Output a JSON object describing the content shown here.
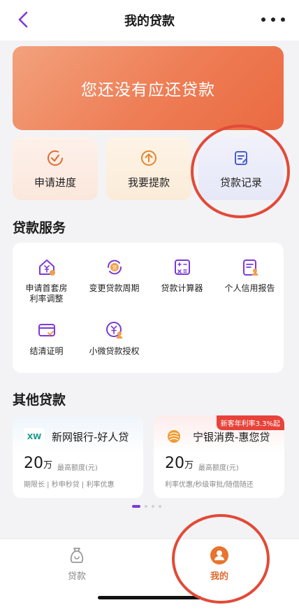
{
  "header": {
    "title": "我的贷款",
    "back_icon": "chevron-left-icon",
    "more_icon": "more-dots-icon"
  },
  "banner": {
    "text": "您还没有应还贷款"
  },
  "quick_actions": [
    {
      "label": "申请进度",
      "icon": "progress-check-icon"
    },
    {
      "label": "我要提款",
      "icon": "withdraw-arrow-up-icon"
    },
    {
      "label": "贷款记录",
      "icon": "record-list-icon"
    }
  ],
  "services": {
    "title": "贷款服务",
    "items": [
      {
        "label_line1": "申请首套房",
        "label_line2": "利率调整",
        "icon": "house-yen-icon"
      },
      {
        "label_line1": "变更贷款周期",
        "label_line2": "",
        "icon": "loan-cycle-icon"
      },
      {
        "label_line1": "贷款计算器",
        "label_line2": "",
        "icon": "calculator-icon"
      },
      {
        "label_line1": "个人信用报告",
        "label_line2": "",
        "icon": "credit-report-icon"
      },
      {
        "label_line1": "结清证明",
        "label_line2": "",
        "icon": "settlement-card-icon"
      },
      {
        "label_line1": "小微贷款授权",
        "label_line2": "",
        "icon": "yen-person-icon"
      }
    ]
  },
  "other_loans": {
    "title": "其他贷款",
    "items": [
      {
        "name": "新网银行-好人贷",
        "logo_text": "XW",
        "amount": "20",
        "unit": "万",
        "hint": "最高额度(元)",
        "tags": "期限长 | 秒申秒贷 | 利率优惠",
        "badge": ""
      },
      {
        "name": "宁银消费-惠您贷",
        "logo_text": "",
        "amount": "20",
        "unit": "万",
        "hint": "最高额度(元)",
        "tags": "利率优惠/秒级审批/随借随还",
        "badge": "新客年利率3.3%起"
      }
    ]
  },
  "tabs": [
    {
      "label": "贷款",
      "icon": "money-bag-icon",
      "active": false
    },
    {
      "label": "我的",
      "icon": "user-profile-icon",
      "active": true
    }
  ],
  "colors": {
    "accent": "#7b3ad6",
    "banner": "#ee7d55",
    "highlight_circle": "#e24a38",
    "active_tab": "#e06a2f"
  }
}
